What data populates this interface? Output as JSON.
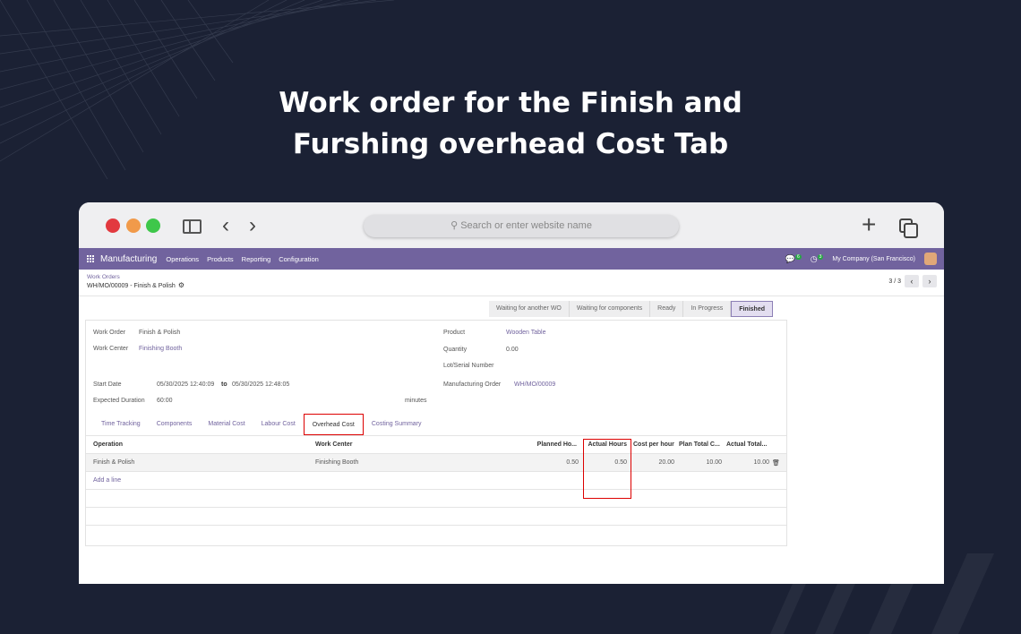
{
  "headline": {
    "line1": "Work order for the Finish and",
    "line2": "Furshing overhead Cost Tab"
  },
  "browser": {
    "url_placeholder": "Search or enter website name"
  },
  "navbar": {
    "app_name": "Manufacturing",
    "menu": [
      "Operations",
      "Products",
      "Reporting",
      "Configuration"
    ],
    "chat_count": "6",
    "activity_count": "3",
    "company": "My Company (San Francisco)"
  },
  "breadcrumb": {
    "parent": "Work Orders",
    "current": "WH/MO/00009 - Finish & Polish"
  },
  "pager": {
    "value": "3 / 3"
  },
  "stages": [
    "Waiting for another WO",
    "Waiting for components",
    "Ready",
    "In Progress",
    "Finished"
  ],
  "active_stage": "Finished",
  "form": {
    "work_order_label": "Work Order",
    "work_order": "Finish & Polish",
    "work_center_label": "Work Center",
    "work_center": "Finishing Booth",
    "start_date_label": "Start Date",
    "start_date": "05/30/2025 12:40:09",
    "to": "to",
    "end_date": "05/30/2025 12:48:05",
    "expected_duration_label": "Expected Duration",
    "expected_duration": "60:00",
    "duration_unit": "minutes",
    "product_label": "Product",
    "product": "Wooden Table",
    "quantity_label": "Quantity",
    "quantity": "0.00",
    "lot_label": "Lot/Serial Number",
    "mo_label": "Manufacturing Order",
    "mo": "WH/MO/00009"
  },
  "tabs": [
    "Time Tracking",
    "Components",
    "Material Cost",
    "Labour Cost",
    "Overhead Cost",
    "Costing Summary"
  ],
  "active_tab": "Overhead Cost",
  "table": {
    "headers": [
      "Operation",
      "Work Center",
      "Planned Ho...",
      "Actual Hours",
      "Cost per hour",
      "Plan Total C...",
      "Actual Total..."
    ],
    "rows": [
      [
        "Finish & Polish",
        "Finishing Booth",
        "0.50",
        "0.50",
        "20.00",
        "10.00",
        "10.00"
      ]
    ],
    "add_line": "Add a line"
  }
}
